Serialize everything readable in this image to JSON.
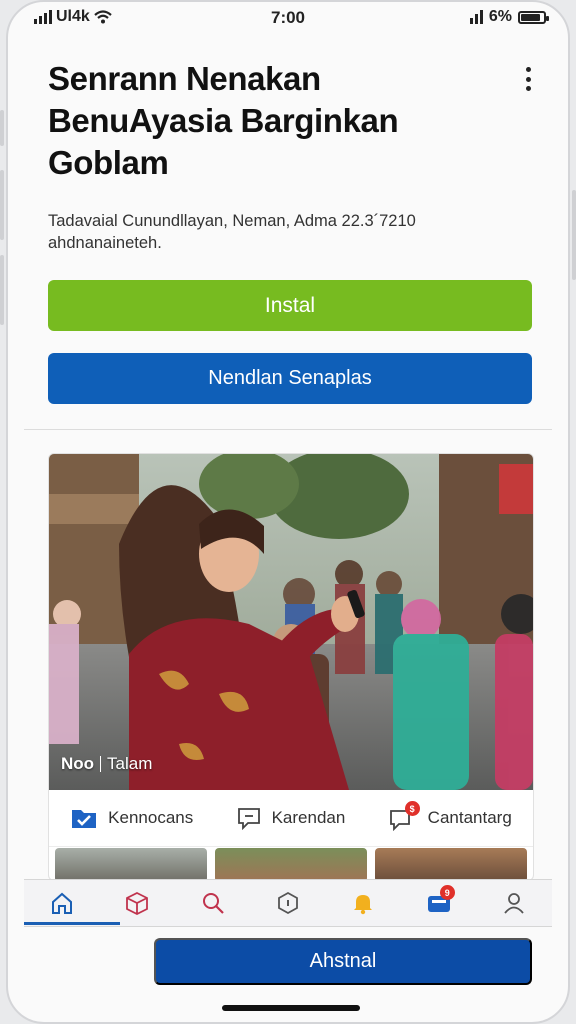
{
  "status_bar": {
    "carrier": "Ul4k",
    "time": "7:00",
    "battery": "6%",
    "battery_level": 0.85
  },
  "app": {
    "title": "Senrann Nenakan BenuAyasia Barginkan Goblam",
    "description": "Tadavaial Cunundllayan, Neman, Adma 22.3´7210 ahdnanaineteh.",
    "install_label": "Instal",
    "secondary_label": "Nendlan Senaplas",
    "bottom_button_label": "Ahstnal"
  },
  "card": {
    "caption_logo": "Noo",
    "caption_text": "Talam",
    "actions": [
      {
        "label": "Kennocans",
        "icon": "folder-check-icon"
      },
      {
        "label": "Karendan",
        "icon": "comment-icon"
      },
      {
        "label": "Cantantarg",
        "icon": "chat-badge-icon",
        "badge": "$"
      }
    ]
  },
  "tabbar": {
    "tabs": [
      {
        "icon": "home-icon",
        "active": true
      },
      {
        "icon": "box-icon"
      },
      {
        "icon": "search-icon"
      },
      {
        "icon": "shield-icon"
      },
      {
        "icon": "bell-icon"
      },
      {
        "icon": "wallet-icon",
        "badge": "9"
      },
      {
        "icon": "profile-icon"
      }
    ]
  },
  "colors": {
    "install": "#77bb20",
    "secondary": "#0f5fb8",
    "bottom_button": "#0c4ca6",
    "active_tab": "#1a5fb4",
    "badge": "#e0302a"
  }
}
